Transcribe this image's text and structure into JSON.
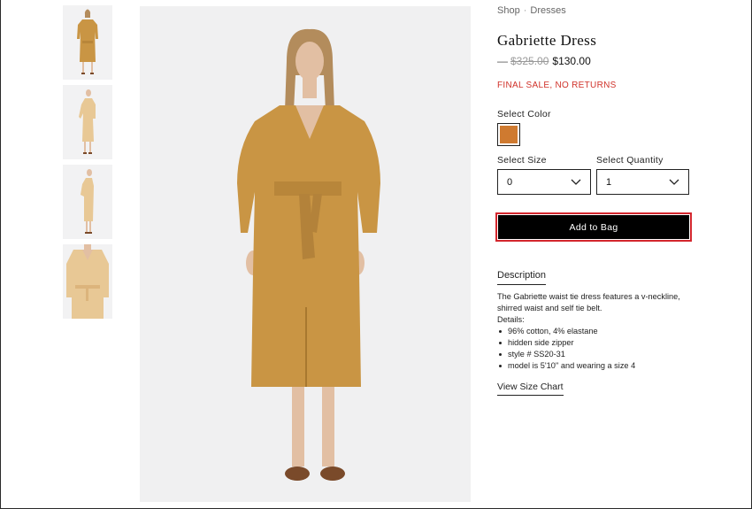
{
  "breadcrumb": {
    "items": [
      "Shop",
      "Dresses"
    ]
  },
  "product": {
    "title": "Gabriette Dress",
    "price_dash": "—",
    "original_price": "$325.00",
    "sale_price": "$130.00",
    "final_sale_notice": "FINAL SALE, NO RETURNS"
  },
  "color": {
    "label": "Select Color",
    "selected_hex": "#cf7a30"
  },
  "size": {
    "label": "Select Size",
    "selected": "0"
  },
  "quantity": {
    "label": "Select Quantity",
    "selected": "1"
  },
  "actions": {
    "add_to_bag": "Add to Bag"
  },
  "description": {
    "tab_label": "Description",
    "text": "The Gabriette waist tie dress features a v-neckline, shirred waist and self tie belt.",
    "details_label": "Details:",
    "details": [
      "96% cotton, 4% elastane",
      "hidden side zipper",
      "style # SS20-31",
      "model is 5'10'' and wearing a size 4"
    ]
  },
  "size_chart_link": "View Size Chart",
  "colors": {
    "dress": "#c99544",
    "dress_light": "#e8c895",
    "skin": "#e2bfa3",
    "hair": "#b38c5c",
    "accent_red": "#d3262d"
  }
}
